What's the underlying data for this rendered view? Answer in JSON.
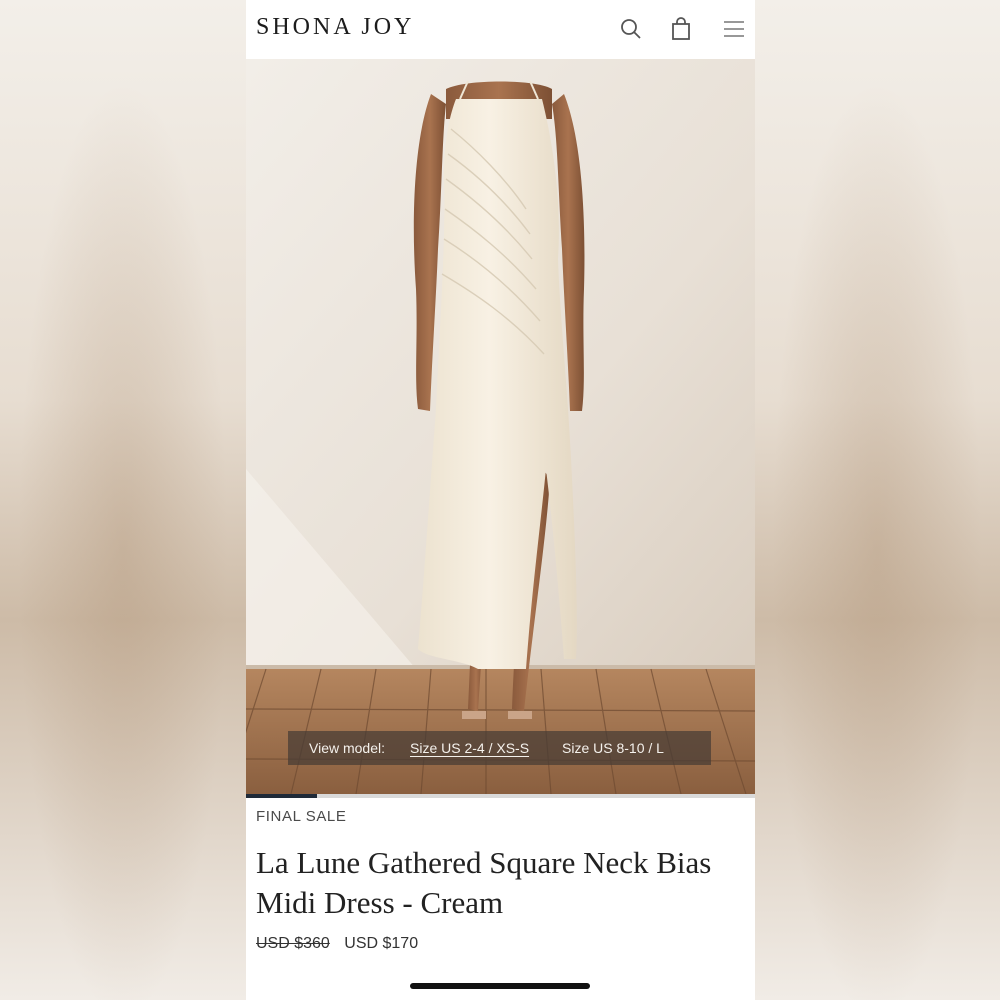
{
  "header": {
    "logo_text": "SHONA JOY",
    "icons": [
      "search-icon",
      "shopping-bag-icon",
      "hamburger-menu-icon"
    ]
  },
  "hero": {
    "view_model_label": "View model:",
    "size_options": [
      "Size US 2-4 / XS-S",
      "Size US 8-10 / L"
    ],
    "selected_size_index": 0,
    "gallery_progress": 0.14
  },
  "product": {
    "badge": "FINAL SALE",
    "title": "La Lune Gathered Square Neck Bias Midi Dress - Cream",
    "old_price": "USD $360",
    "new_price": "USD $170"
  },
  "colors": {
    "accent": "#1f2a38",
    "dress": "#f3ead9",
    "floor": "#9c6f4a"
  }
}
